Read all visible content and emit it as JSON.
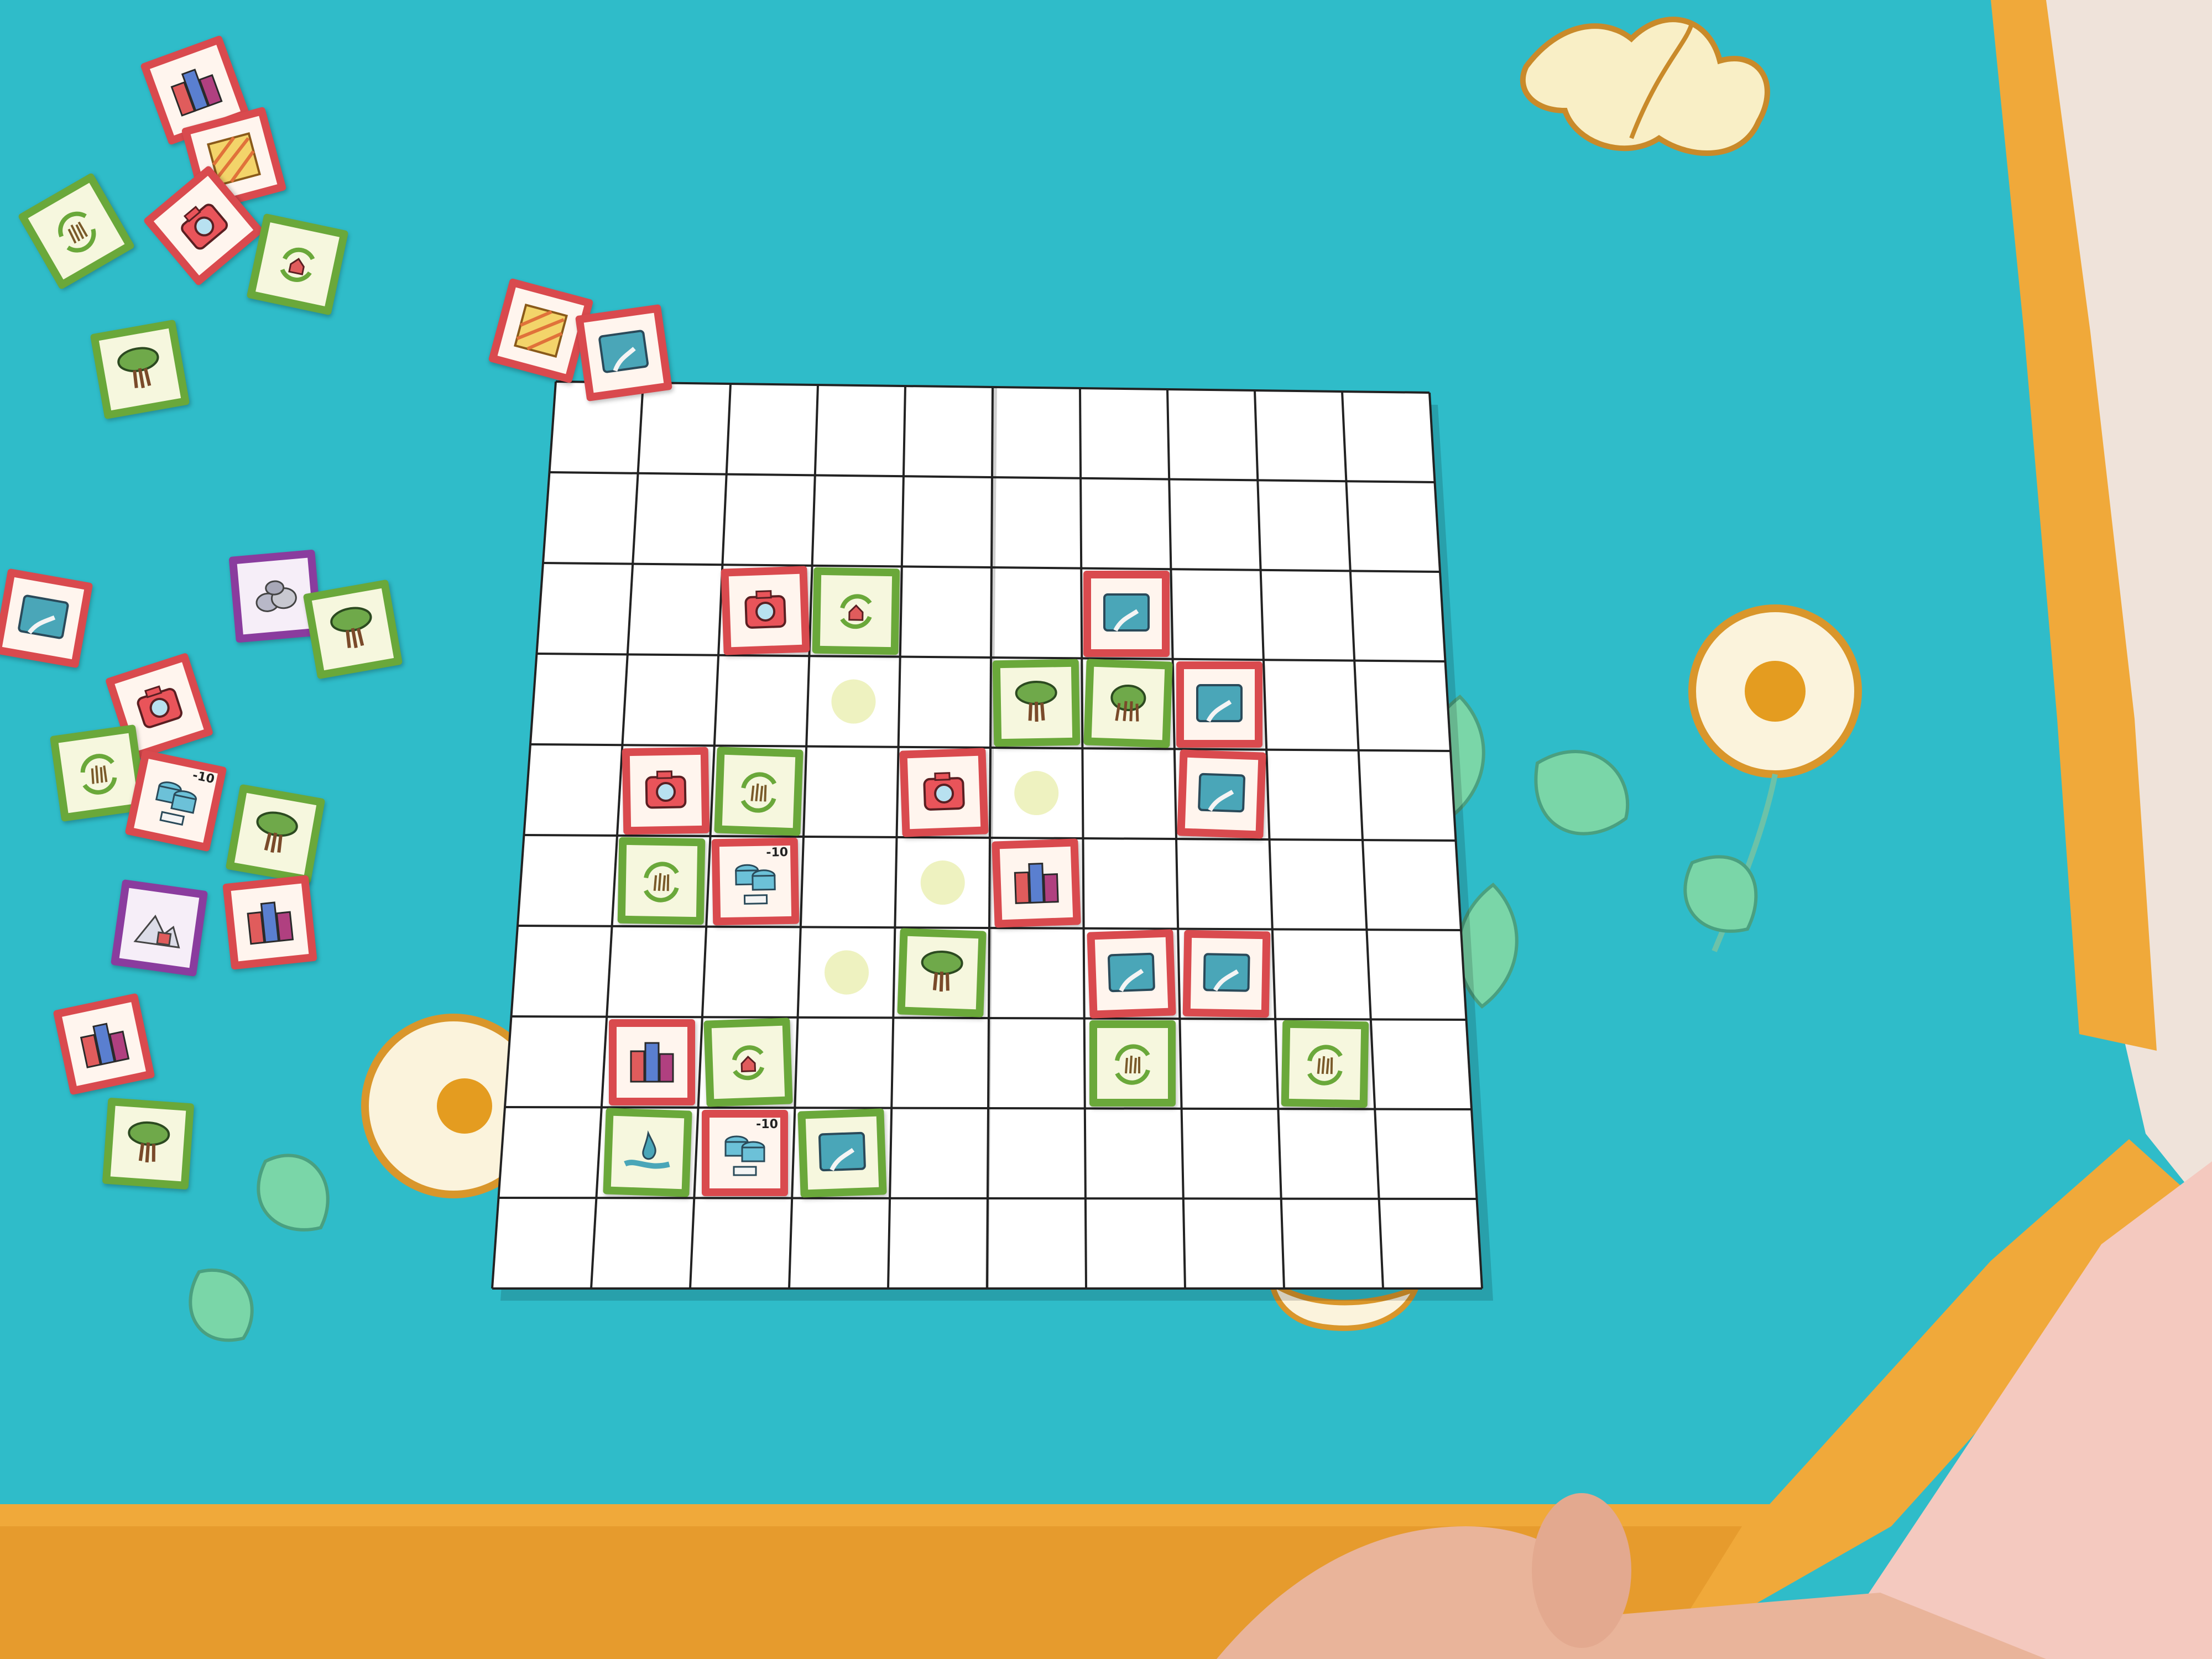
{
  "game": {
    "board_columns": 10,
    "board_rows": 10,
    "colors": {
      "cloth": "#33c3d0",
      "paper": "#ffffff",
      "grid_line": "#222222",
      "red_tile_border": "#d94a4e",
      "green_tile_border": "#6aa83a",
      "purple_tile_border": "#8a3c9e",
      "fringe": "#f0a93a",
      "marker": "#eef2c0"
    },
    "board_tiles": [
      {
        "row": 2,
        "col": 2,
        "color": "red",
        "icon": "camera-icon"
      },
      {
        "row": 2,
        "col": 3,
        "color": "green",
        "icon": "recycle-house-icon"
      },
      {
        "row": 2,
        "col": 6,
        "color": "red",
        "icon": "river-icon"
      },
      {
        "row": 3,
        "col": 5,
        "color": "green",
        "icon": "tree-icon"
      },
      {
        "row": 3,
        "col": 6,
        "color": "green",
        "icon": "grass-icon"
      },
      {
        "row": 3,
        "col": 7,
        "color": "red",
        "icon": "river-icon"
      },
      {
        "row": 4,
        "col": 1,
        "color": "red",
        "icon": "camera-icon"
      },
      {
        "row": 4,
        "col": 2,
        "color": "green",
        "icon": "recycle-grass-icon"
      },
      {
        "row": 4,
        "col": 4,
        "color": "red",
        "icon": "camera-icon"
      },
      {
        "row": 4,
        "col": 7,
        "color": "red",
        "icon": "river-icon"
      },
      {
        "row": 5,
        "col": 1,
        "color": "green",
        "icon": "recycle-grass-icon"
      },
      {
        "row": 5,
        "col": 2,
        "color": "red",
        "icon": "water-tanks-icon",
        "badge": "-10"
      },
      {
        "row": 5,
        "col": 5,
        "color": "red",
        "icon": "city-icon"
      },
      {
        "row": 6,
        "col": 4,
        "color": "green",
        "icon": "tree-icon"
      },
      {
        "row": 6,
        "col": 6,
        "color": "red",
        "icon": "river-icon"
      },
      {
        "row": 6,
        "col": 7,
        "color": "red",
        "icon": "river-icon"
      },
      {
        "row": 7,
        "col": 1,
        "color": "red",
        "icon": "city-icon"
      },
      {
        "row": 7,
        "col": 2,
        "color": "green",
        "icon": "recycle-house-icon"
      },
      {
        "row": 7,
        "col": 6,
        "color": "green",
        "icon": "recycle-grass-icon"
      },
      {
        "row": 7,
        "col": 8,
        "color": "green",
        "icon": "recycle-grass-icon"
      },
      {
        "row": 8,
        "col": 1,
        "color": "green",
        "icon": "water-drop-icon"
      },
      {
        "row": 8,
        "col": 2,
        "color": "red",
        "icon": "water-tanks-icon",
        "badge": "-10"
      },
      {
        "row": 8,
        "col": 3,
        "color": "green",
        "icon": "river-icon"
      }
    ],
    "markers": [
      {
        "row": 3,
        "col": 3
      },
      {
        "row": 4,
        "col": 5
      },
      {
        "row": 5,
        "col": 4
      },
      {
        "row": 6,
        "col": 3
      }
    ],
    "pile_tiles": [
      {
        "color": "red",
        "icon": "city-icon"
      },
      {
        "color": "red",
        "icon": "field-icon"
      },
      {
        "color": "green",
        "icon": "recycle-grass-icon"
      },
      {
        "color": "red",
        "icon": "camera-icon"
      },
      {
        "color": "green",
        "icon": "recycle-house-icon"
      },
      {
        "color": "red",
        "icon": "field-icon"
      },
      {
        "color": "green",
        "icon": "tree-icon"
      },
      {
        "color": "red",
        "icon": "river-icon"
      },
      {
        "color": "purple",
        "icon": "rocks-icon"
      },
      {
        "color": "green",
        "icon": "tree-icon"
      },
      {
        "color": "red",
        "icon": "river-icon"
      },
      {
        "color": "red",
        "icon": "camera-icon"
      },
      {
        "color": "green",
        "icon": "recycle-grass-icon"
      },
      {
        "color": "red",
        "icon": "water-tanks-icon",
        "badge": "-10"
      },
      {
        "color": "green",
        "icon": "tree-icon"
      },
      {
        "color": "purple",
        "icon": "mountain-house-icon"
      },
      {
        "color": "red",
        "icon": "city-icon"
      },
      {
        "color": "red",
        "icon": "city-icon"
      },
      {
        "color": "green",
        "icon": "tree-icon"
      }
    ]
  }
}
